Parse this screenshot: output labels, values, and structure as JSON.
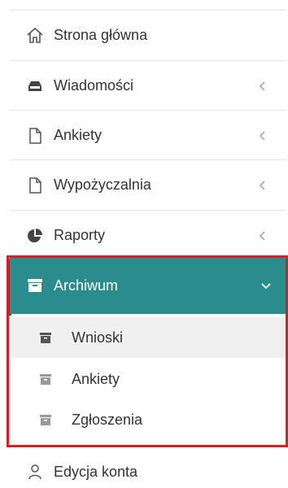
{
  "sidebar": {
    "items": [
      {
        "label": "Strona główna",
        "icon": "home-icon"
      },
      {
        "label": "Wiadomości",
        "icon": "inbox-icon",
        "expandable": true
      },
      {
        "label": "Ankiety",
        "icon": "document-icon",
        "expandable": true
      },
      {
        "label": "Wypożyczalnia",
        "icon": "document-icon",
        "expandable": true
      },
      {
        "label": "Raporty",
        "icon": "pie-chart-icon",
        "expandable": true
      }
    ],
    "active": {
      "label": "Archiwum",
      "icon": "archive-icon",
      "expanded": true,
      "subitems": [
        {
          "label": "Wnioski",
          "icon": "archive-icon",
          "selected": true
        },
        {
          "label": "Ankiety",
          "icon": "archive-icon"
        },
        {
          "label": "Zgłoszenia",
          "icon": "archive-icon"
        }
      ]
    },
    "bottom_item": {
      "label": "Edycja konta",
      "icon": "user-icon"
    }
  },
  "colors": {
    "active_bg": "#2a8c8c",
    "highlight_border": "#e01b24",
    "selected_sub_bg": "#f0f0f0"
  }
}
